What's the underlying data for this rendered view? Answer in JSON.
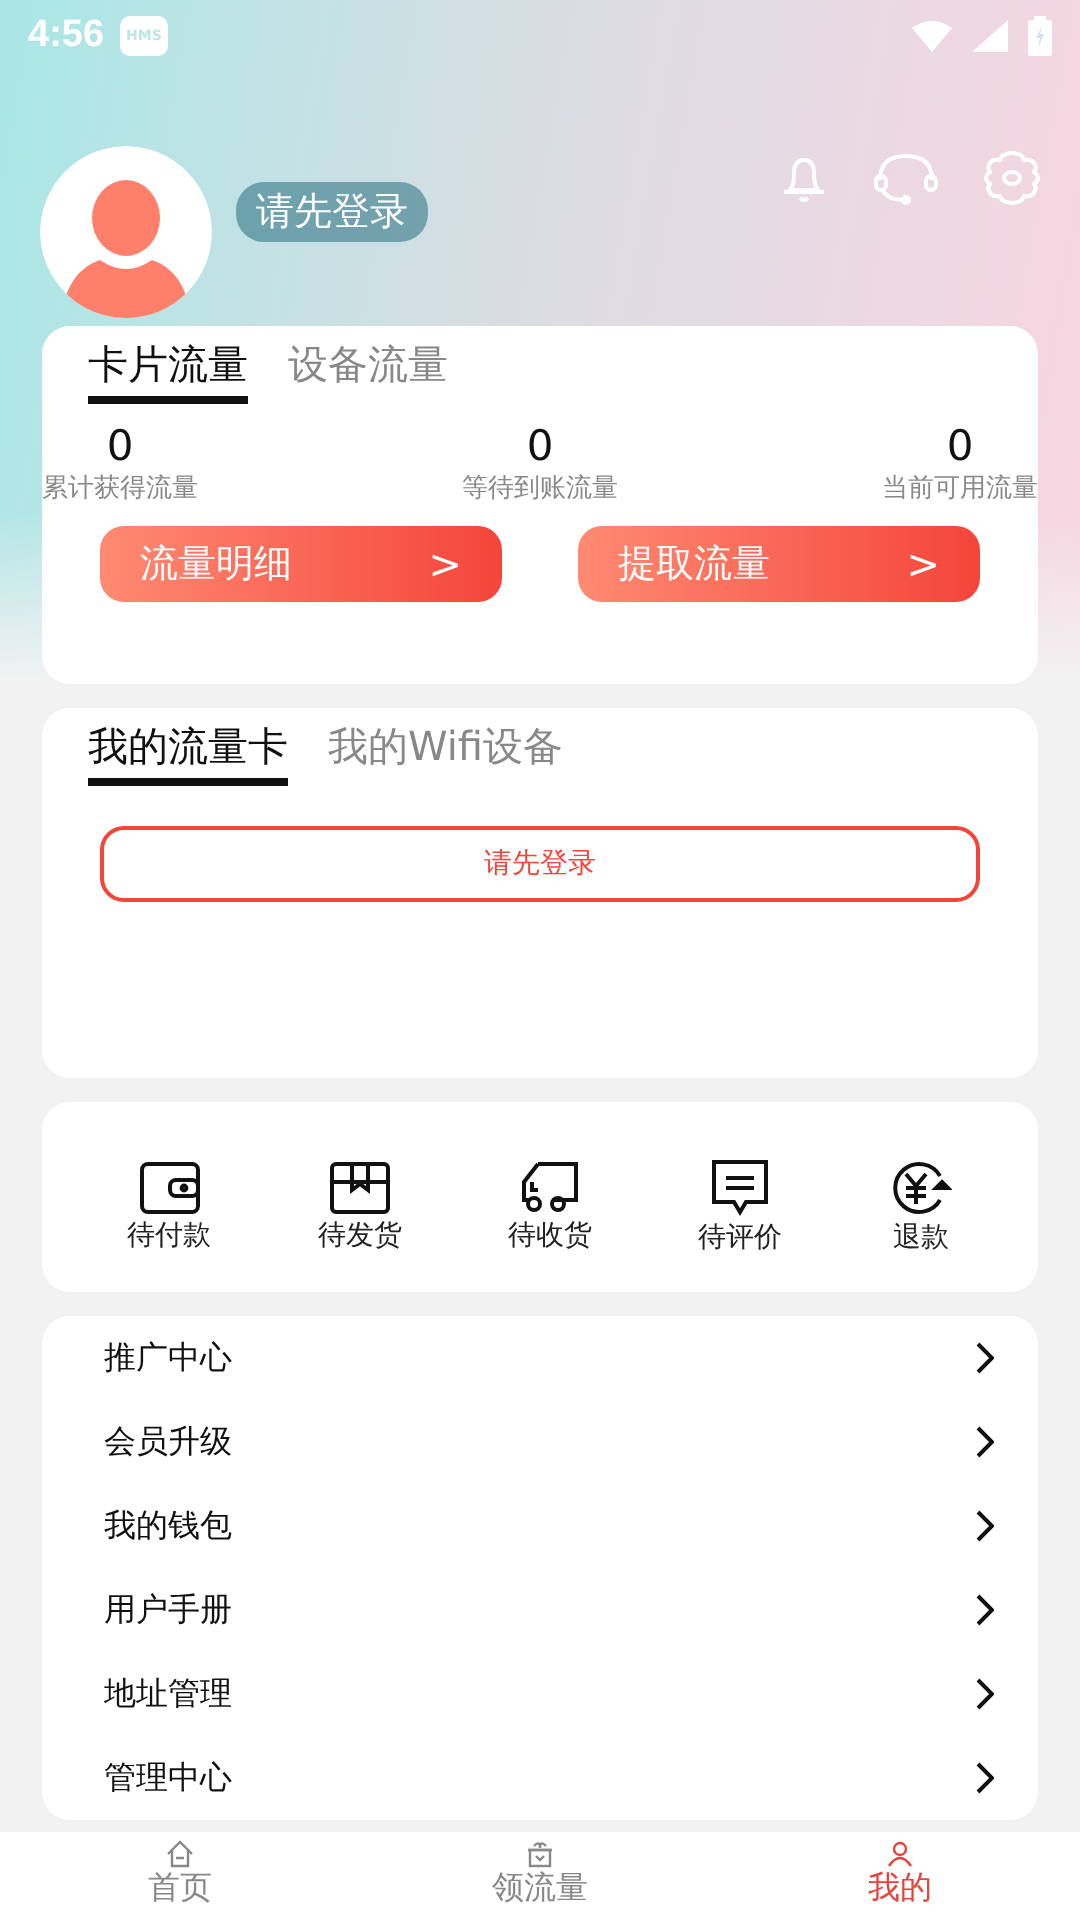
{
  "status_bar": {
    "time": "4:56",
    "badge": "HMS"
  },
  "profile": {
    "name": "请先登录"
  },
  "flow_card": {
    "tabs": [
      {
        "label": "卡片流量",
        "selected": true
      },
      {
        "label": "设备流量",
        "selected": false
      }
    ],
    "stats": [
      {
        "value": "0",
        "label": "累计获得流量"
      },
      {
        "value": "0",
        "label": "等待到账流量"
      },
      {
        "value": "0",
        "label": "当前可用流量"
      }
    ],
    "buttons": [
      {
        "label": "流量明细",
        "icon": ">"
      },
      {
        "label": "提取流量",
        "icon": ">"
      }
    ]
  },
  "my_card": {
    "tabs": [
      {
        "label": "我的流量卡",
        "selected": true
      },
      {
        "label": "我的Wifi设备",
        "selected": false
      }
    ],
    "login_button": "请先登录"
  },
  "orders": [
    {
      "kind": "wallet",
      "label": "待付款"
    },
    {
      "kind": "box",
      "label": "待发货"
    },
    {
      "kind": "truck",
      "label": "待收货"
    },
    {
      "kind": "comment",
      "label": "待评价"
    },
    {
      "kind": "refund",
      "label": "退款"
    }
  ],
  "menu": [
    {
      "label": "推广中心"
    },
    {
      "label": "会员升级"
    },
    {
      "label": "我的钱包"
    },
    {
      "label": "用户手册"
    },
    {
      "label": "地址管理"
    },
    {
      "label": "管理中心"
    }
  ],
  "tab_bar": [
    {
      "kind": "home",
      "label": "首页",
      "selected": false
    },
    {
      "kind": "gift",
      "label": "领流量",
      "selected": false
    },
    {
      "kind": "person",
      "label": "我的",
      "selected": true
    }
  ]
}
